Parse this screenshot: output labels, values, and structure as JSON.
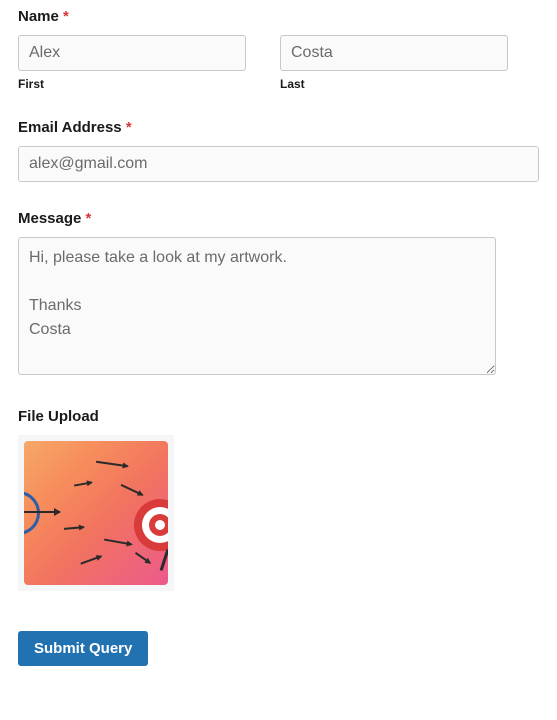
{
  "name": {
    "label": "Name",
    "required": "*",
    "first": {
      "value": "Alex",
      "sublabel": "First"
    },
    "last": {
      "value": "Costa",
      "sublabel": "Last"
    }
  },
  "email": {
    "label": "Email Address",
    "required": "*",
    "value": "alex@gmail.com"
  },
  "message": {
    "label": "Message",
    "required": "*",
    "value": "Hi, please take a look at my artwork.\n\nThanks\nCosta"
  },
  "upload": {
    "label": "File Upload"
  },
  "submit": {
    "label": "Submit Query"
  }
}
